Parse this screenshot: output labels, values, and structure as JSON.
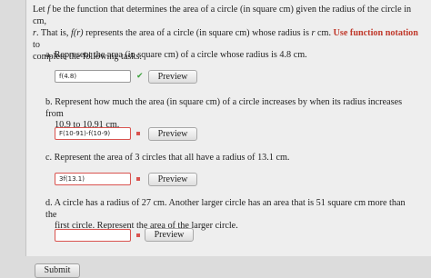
{
  "intro": {
    "line1_pre": "Let ",
    "func": "f",
    "line1_post": " be the function that determines the area of a circle (in square cm) given the radius of the circle in cm,",
    "line2_var": "r",
    "line2_a": ". That is, ",
    "notation": "f(r)",
    "line2_b": " represents the area of a circle (in square cm) whose radius is ",
    "line2_var2": "r",
    "line2_c": " cm. ",
    "emphasis": "Use function notation",
    "line2_d": " to",
    "line3": "complete the following tasks."
  },
  "tasks": [
    {
      "letter": "a.",
      "line1": "Represent the area (in square cm) of a circle whose radius is 4.8 cm.",
      "line2": "",
      "answer": "f(4.8)",
      "status": "correct",
      "preview_label": "Preview"
    },
    {
      "letter": "b.",
      "line1": "Represent how much the area (in square cm) of a circle increases by when its radius increases from",
      "line2": "10.9 to 10.91 cm.",
      "answer": "F(10-91)-f(10-9)",
      "status": "incorrect",
      "preview_label": "Preview"
    },
    {
      "letter": "c.",
      "line1": "Represent the area of 3 circles that all have a radius of 13.1 cm.",
      "line2": "",
      "answer": "3f(13.1)",
      "status": "incorrect",
      "preview_label": "Preview"
    },
    {
      "letter": "d.",
      "line1": "A circle has a radius of 27 cm. Another larger circle has an area that is 51 square cm more than the",
      "line2": "first circle. Represent the area of the larger circle.",
      "answer": "",
      "status": "incorrect",
      "preview_label": "Preview"
    }
  ],
  "submit_label": "Submit",
  "colors": {
    "correct": "#3aa03a",
    "incorrect": "#d9534f",
    "emphasis": "#c0392b"
  },
  "icons": {
    "correct": "check-icon",
    "incorrect": "x-mark-icon"
  }
}
